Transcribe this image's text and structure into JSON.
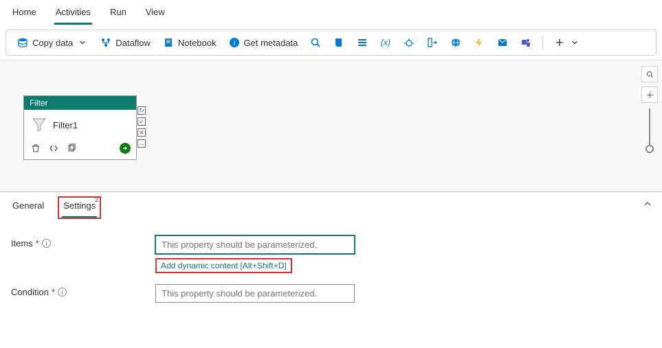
{
  "topTabs": {
    "home": "Home",
    "activities": "Activities",
    "run": "Run",
    "view": "View"
  },
  "toolbar": {
    "copyData": "Copy data",
    "dataflow": "Dataflow",
    "notebook": "Notebook",
    "getMetadata": "Get metadata"
  },
  "canvas": {
    "nodeType": "Filter",
    "nodeName": "Filter1"
  },
  "bottomTabs": {
    "general": "General",
    "settings": "Settings",
    "settingsBadge": "2"
  },
  "form": {
    "itemsLabel": "Items",
    "itemsPlaceholder": "This property should be parameterized.",
    "dynamicLink": "Add dynamic content [Alt+Shift+D]",
    "conditionLabel": "Condition",
    "conditionPlaceholder": "This property should be parameterized."
  }
}
